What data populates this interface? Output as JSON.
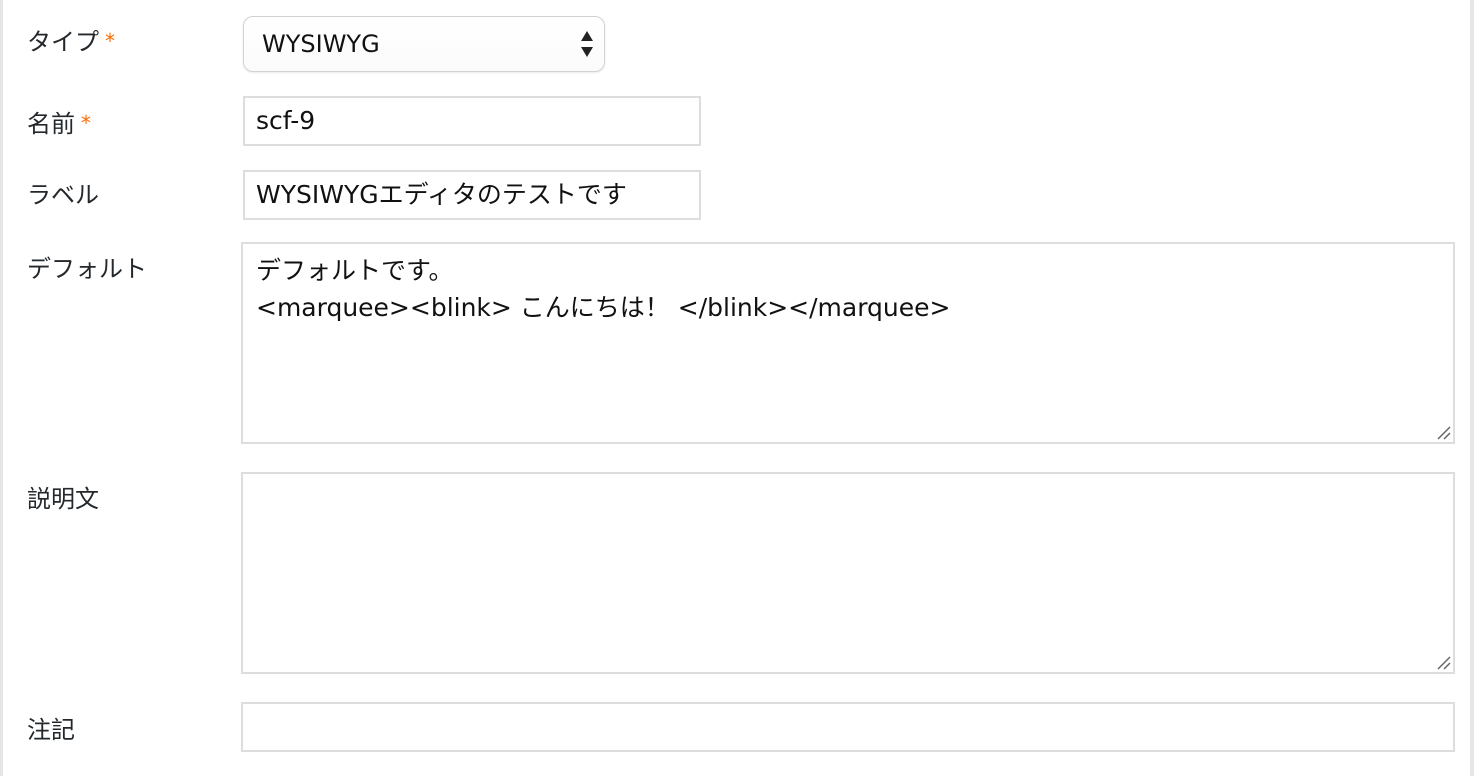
{
  "form": {
    "type": {
      "label": "タイプ",
      "required_mark": "*",
      "selected": "WYSIWYG"
    },
    "name": {
      "label": "名前",
      "required_mark": "*",
      "value": "scf-9"
    },
    "display_label": {
      "label": "ラベル",
      "value": "WYSIWYGエディタのテストです"
    },
    "default": {
      "label": "デフォルト",
      "lines": [
        "デフォルトです。",
        "<marquee><blink> こんにちは！ </blink></marquee>"
      ]
    },
    "description": {
      "label": "説明文",
      "value": ""
    },
    "notes": {
      "label": "注記",
      "value": ""
    }
  },
  "colors": {
    "required": "#ff6a00",
    "border": "#dddddd",
    "text": "#23282d"
  }
}
